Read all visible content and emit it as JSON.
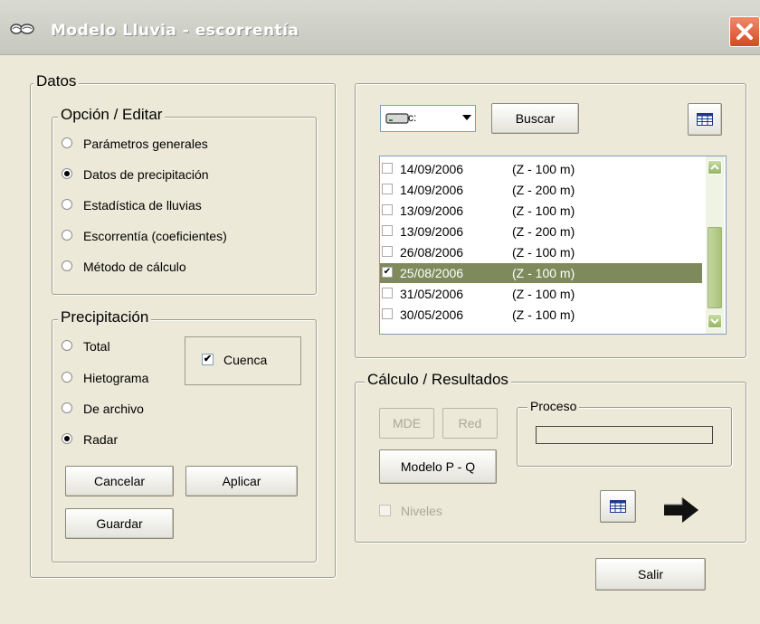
{
  "window": {
    "title": "Modelo Lluvia - escorrentía",
    "icon": "clouds-icon",
    "close_icon": "close-icon"
  },
  "datos": {
    "legend": "Datos",
    "opcion": {
      "legend": "Opción / Editar",
      "options": [
        {
          "label": "Parámetros generales",
          "selected": false
        },
        {
          "label": "Datos de precipitación",
          "selected": true
        },
        {
          "label": "Estadística de lluvias",
          "selected": false
        },
        {
          "label": "Escorrentía (coeficientes)",
          "selected": false
        },
        {
          "label": "Método de cálculo",
          "selected": false
        }
      ]
    },
    "precipitacion": {
      "legend": "Precipitación",
      "options": [
        {
          "label": "Total",
          "selected": false
        },
        {
          "label": "Hietograma",
          "selected": false
        },
        {
          "label": "De archivo",
          "selected": false
        },
        {
          "label": "Radar",
          "selected": true
        }
      ],
      "cuenca": {
        "label": "Cuenca",
        "checked": true
      },
      "buttons": {
        "cancelar": "Cancelar",
        "aplicar": "Aplicar",
        "guardar": "Guardar"
      }
    }
  },
  "files": {
    "drive": {
      "value": "c:",
      "icon": "hard-drive-icon"
    },
    "buscar_label": "Buscar",
    "table_icon": "table-icon",
    "items": [
      {
        "date": "14/09/2006",
        "z": "(Z - 100 m)",
        "checked": false,
        "selected": false
      },
      {
        "date": "14/09/2006",
        "z": "(Z - 200 m)",
        "checked": false,
        "selected": false
      },
      {
        "date": "13/09/2006",
        "z": "(Z - 100 m)",
        "checked": false,
        "selected": false
      },
      {
        "date": "13/09/2006",
        "z": "(Z - 200 m)",
        "checked": false,
        "selected": false
      },
      {
        "date": "26/08/2006",
        "z": "(Z - 100 m)",
        "checked": false,
        "selected": false
      },
      {
        "date": "25/08/2006",
        "z": "(Z - 100 m)",
        "checked": true,
        "selected": true
      },
      {
        "date": "31/05/2006",
        "z": "(Z - 100 m)",
        "checked": false,
        "selected": false
      },
      {
        "date": "30/05/2006",
        "z": "(Z - 100 m)",
        "checked": false,
        "selected": false
      }
    ]
  },
  "calculo": {
    "legend": "Cálculo / Resultados",
    "mde_label": "MDE",
    "red_label": "Red",
    "modelo_label": "Modelo P - Q",
    "niveles_label": "Niveles",
    "proceso_legend": "Proceso",
    "progress": 0,
    "table_icon": "table-icon",
    "arrow_icon": "arrow-right-icon"
  },
  "salir_label": "Salir"
}
